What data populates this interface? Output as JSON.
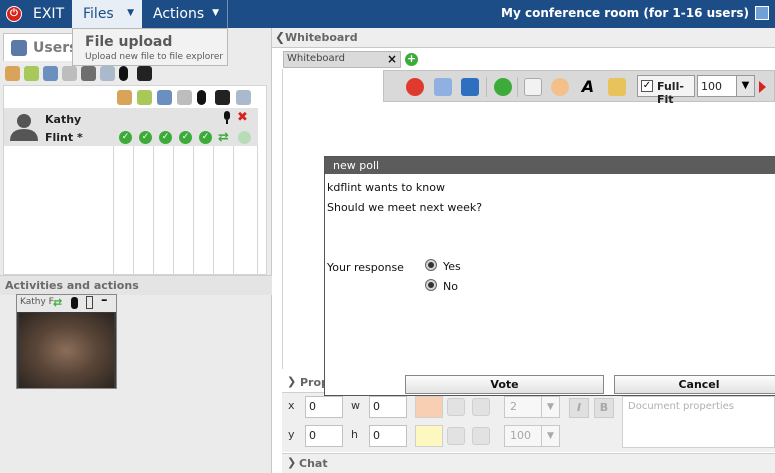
{
  "topbar": {
    "exit_label": "EXIT",
    "menu_files": "Files",
    "menu_actions": "Actions",
    "room_title": "My conference room (for 1-16 users)"
  },
  "files_dropdown": {
    "title": "File upload",
    "subtitle": "Upload new file to file explorer"
  },
  "left_panel": {
    "users_tab_label": "Users",
    "user_first": "Kathy",
    "user_last": "Flint *",
    "activities_label": "Activities and actions",
    "video_label": "Kathy F"
  },
  "whiteboard": {
    "header": "Whiteboard",
    "tab_label": "Whiteboard",
    "fullfit_label": "Full-Fit",
    "zoom_value": "100"
  },
  "properties": {
    "header": "Prop",
    "x_label": "x",
    "x_value": "0",
    "y_label": "y",
    "y_value": "0",
    "w_label": "w",
    "w_value": "0",
    "h_label": "h",
    "h_value": "0",
    "line_width": "2",
    "opacity": "100",
    "italic_label": "I",
    "bold_label": "B",
    "doc_props_placeholder": "Document properties",
    "colors": {
      "line": "#f9cfb4",
      "fill": "#fdf7c0"
    }
  },
  "chat": {
    "header": "Chat"
  },
  "poll": {
    "title": "new poll",
    "asker": "kdflint wants to know",
    "question": "Should we meet next week?",
    "response_label": "Your response",
    "options": [
      "Yes",
      "No"
    ],
    "vote_label": "Vote",
    "cancel_label": "Cancel"
  },
  "icons": {
    "exit": "power-icon",
    "toolbar": [
      "delete-icon",
      "new-document-icon",
      "save-icon",
      "refresh-icon",
      "pointer-icon",
      "lasso-icon",
      "text-icon",
      "pen-icon"
    ]
  }
}
